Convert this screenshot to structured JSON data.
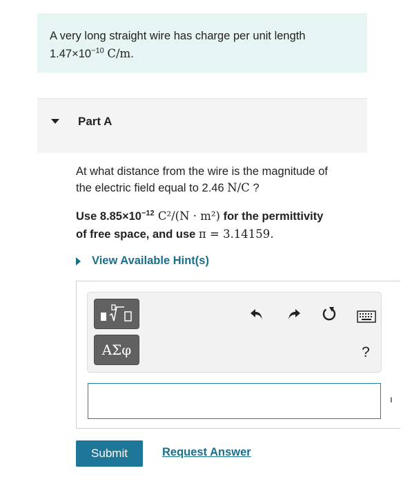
{
  "intro": {
    "text": "A very long straight wire has charge per unit length",
    "value_mantissa": "1.47×10",
    "value_exponent": "−10",
    "value_unit": "C/m",
    "period": "."
  },
  "part": {
    "title": "Part A"
  },
  "question": {
    "line1": "At what distance from the wire is the magnitude of",
    "line2_prefix": "the electric field equal to 2.46 ",
    "line2_unit": "N/C",
    "line2_suffix": " ?"
  },
  "instructions": {
    "use": "Use 8.85×10",
    "exp": "−12",
    "unit": " C²/(N · m²)",
    "mid": " for the permittivity",
    "line2_prefix": "of free space, and use ",
    "pi_expr": "π = 3.14159",
    "period": "."
  },
  "hint": {
    "label": "View Available Hint(s)"
  },
  "toolbar": {
    "greek_label": "ΑΣφ",
    "help_label": "?",
    "icons": [
      "templates-icon",
      "undo-icon",
      "redo-icon",
      "reset-icon",
      "keyboard-icon"
    ]
  },
  "answer": {
    "value": "",
    "units_glyph": "ı"
  },
  "actions": {
    "submit": "Submit",
    "request": "Request Answer"
  },
  "colors": {
    "intro_bg": "#e6f4f4",
    "link": "#1a6f8a",
    "submit_bg": "#1e7799",
    "input_border": "#1e7fa0"
  }
}
